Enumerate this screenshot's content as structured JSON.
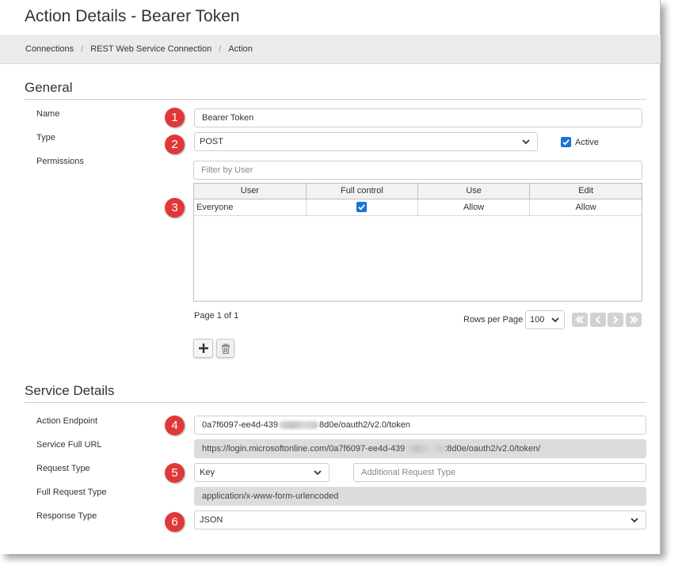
{
  "page": {
    "title": "Action Details - Bearer Token"
  },
  "breadcrumb": [
    "Connections",
    "REST Web Service Connection",
    "Action"
  ],
  "general": {
    "heading": "General",
    "name_label": "Name",
    "name_value": "Bearer Token",
    "type_label": "Type",
    "type_value": "POST",
    "active_label": "Active",
    "active_checked": true,
    "permissions_label": "Permissions",
    "filter_placeholder": "Filter by User"
  },
  "permissions_table": {
    "columns": [
      "User",
      "Full control",
      "Use",
      "Edit"
    ],
    "rows": [
      {
        "user": "Everyone",
        "full_control": true,
        "use": "Allow",
        "edit": "Allow"
      }
    ]
  },
  "pager": {
    "page_info": "Page 1 of 1",
    "rows_label": "Rows per Page",
    "rows_value": "100"
  },
  "service": {
    "heading": "Service Details",
    "endpoint_label": "Action Endpoint",
    "endpoint_prefix": "0a7f6097-ee4d-439",
    "endpoint_suffix": "8d0e/oauth2/v2.0/token",
    "full_url_label": "Service Full URL",
    "full_url_prefix": "https://login.microsoftonline.com/0a7f6097-ee4d-439",
    "full_url_suffix": ":8d0e/oauth2/v2.0/token/",
    "request_type_label": "Request Type",
    "request_type_value": "Key",
    "additional_placeholder": "Additional Request Type",
    "full_request_label": "Full Request Type",
    "full_request_value": "application/x-www-form-urlencoded",
    "response_type_label": "Response Type",
    "response_type_value": "JSON"
  },
  "badges": [
    "1",
    "2",
    "3",
    "4",
    "5",
    "6"
  ],
  "colors": {
    "badge": "#e03838",
    "checkbox": "#1a73d9",
    "readonly_bg": "#dcdcdc"
  },
  "icons": [
    "chevron-down-icon",
    "checkmark-icon",
    "first-page-icon",
    "prev-page-icon",
    "next-page-icon",
    "last-page-icon",
    "plus-icon",
    "trash-icon"
  ]
}
